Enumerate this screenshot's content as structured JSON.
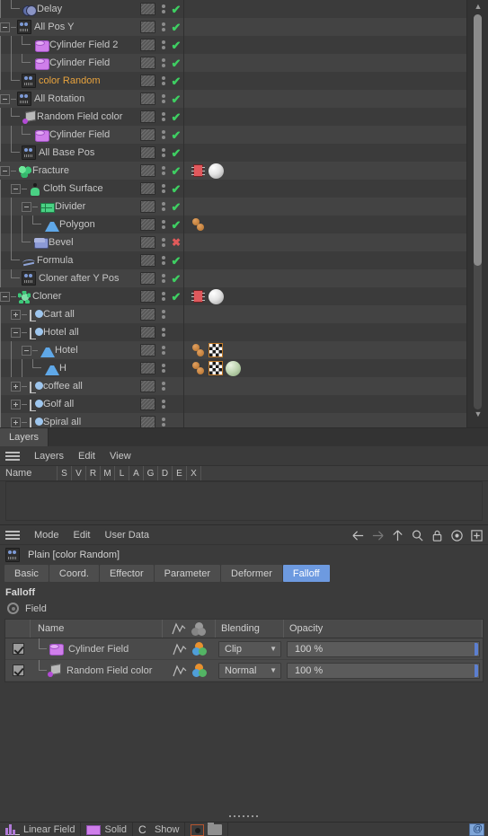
{
  "object_manager": {
    "rows": [
      {
        "label": "Delay",
        "depth": 1,
        "expander": "none",
        "icon": "delay-icon",
        "check": "on",
        "tags": []
      },
      {
        "label": "All Pos Y",
        "depth": 0,
        "expander": "minus",
        "icon": "effector-icon",
        "check": "on",
        "tags": []
      },
      {
        "label": "Cylinder Field 2",
        "depth": 2,
        "expander": "none",
        "icon": "cylinder-field-icon",
        "check": "on",
        "tags": []
      },
      {
        "label": "Cylinder Field",
        "depth": 2,
        "expander": "none",
        "icon": "cylinder-field-icon",
        "check": "on",
        "tags": []
      },
      {
        "label": "color Random",
        "depth": 1,
        "expander": "none",
        "icon": "effector-icon",
        "check": "on",
        "selected": true,
        "tags": []
      },
      {
        "label": "All Rotation",
        "depth": 0,
        "expander": "minus",
        "icon": "effector-icon",
        "check": "on",
        "tags": []
      },
      {
        "label": "Random Field color",
        "depth": 1,
        "expander": "none",
        "icon": "random-field-icon",
        "check": "on",
        "tags": []
      },
      {
        "label": "Cylinder Field",
        "depth": 2,
        "expander": "none",
        "icon": "cylinder-field-icon",
        "check": "on",
        "tags": []
      },
      {
        "label": "All Base Pos",
        "depth": 1,
        "expander": "none",
        "icon": "effector-icon",
        "check": "on",
        "tags": []
      },
      {
        "label": "Fracture",
        "depth": 0,
        "expander": "minus",
        "icon": "fracture-icon",
        "check": "on",
        "tags": [
          "rigid-body-tag",
          "material-white"
        ]
      },
      {
        "label": "Cloth Surface",
        "depth": 1,
        "expander": "minus",
        "icon": "cloth-surface-icon",
        "check": "on",
        "tags": []
      },
      {
        "label": "Divider",
        "depth": 2,
        "expander": "minus",
        "icon": "divider-icon",
        "check": "on",
        "tags": []
      },
      {
        "label": "Polygon",
        "depth": 3,
        "expander": "none",
        "icon": "polygon-icon",
        "check": "on",
        "tags": [
          "dynamics-tag"
        ]
      },
      {
        "label": "Bevel",
        "depth": 2,
        "expander": "none",
        "icon": "bevel-icon",
        "check": "off",
        "tags": []
      },
      {
        "label": "Formula",
        "depth": 1,
        "expander": "none",
        "icon": "formula-icon",
        "check": "on",
        "tags": []
      },
      {
        "label": "Cloner after Y Pos",
        "depth": 1,
        "expander": "none",
        "icon": "effector-icon",
        "check": "on",
        "tags": []
      },
      {
        "label": "Cloner",
        "depth": 0,
        "expander": "minus",
        "icon": "cloner-icon",
        "check": "on",
        "tags": [
          "rigid-body-tag",
          "material-white"
        ]
      },
      {
        "label": "Cart all",
        "depth": 1,
        "expander": "plus",
        "icon": "null-object-icon",
        "check": "none",
        "tags": []
      },
      {
        "label": "Hotel all",
        "depth": 1,
        "expander": "minus",
        "icon": "null-object-icon",
        "check": "none",
        "tags": []
      },
      {
        "label": "Hotel",
        "depth": 2,
        "expander": "minus",
        "icon": "polygon-icon",
        "check": "none",
        "tags": [
          "dynamics-tag",
          "checker-texture-tag"
        ]
      },
      {
        "label": "H",
        "depth": 3,
        "expander": "none",
        "icon": "polygon-icon",
        "check": "none",
        "tags": [
          "dynamics-tag",
          "checker-texture-tag",
          "material-green"
        ]
      },
      {
        "label": "coffee all",
        "depth": 1,
        "expander": "plus",
        "icon": "null-object-icon",
        "check": "none",
        "tags": []
      },
      {
        "label": "Golf all",
        "depth": 1,
        "expander": "plus",
        "icon": "null-object-icon",
        "check": "none",
        "tags": []
      },
      {
        "label": "Spiral all",
        "depth": 1,
        "expander": "plus",
        "icon": "null-object-icon",
        "check": "none",
        "tags": []
      }
    ]
  },
  "layers_panel": {
    "tab_label": "Layers",
    "menus": [
      "Layers",
      "Edit",
      "View"
    ],
    "columns": [
      "Name",
      "S",
      "V",
      "R",
      "M",
      "L",
      "A",
      "G",
      "D",
      "E",
      "X"
    ]
  },
  "attribute_manager": {
    "menus": [
      "Mode",
      "Edit",
      "User Data"
    ],
    "nav_icons": [
      "back-arrow-icon",
      "forward-arrow-icon",
      "up-arrow-icon",
      "search-icon",
      "lock-icon",
      "target-icon",
      "add-icon"
    ],
    "object_title": "Plain [color Random]",
    "tabs": [
      {
        "label": "Basic",
        "active": false
      },
      {
        "label": "Coord.",
        "active": false
      },
      {
        "label": "Effector",
        "active": false
      },
      {
        "label": "Parameter",
        "active": false
      },
      {
        "label": "Deformer",
        "active": false
      },
      {
        "label": "Falloff",
        "active": true
      }
    ],
    "section_title": "Falloff",
    "mode_label": "Field",
    "field_list": {
      "headers": {
        "name": "Name",
        "blending": "Blending",
        "opacity": "Opacity"
      },
      "rows": [
        {
          "checked": true,
          "name": "Cylinder Field",
          "icon": "cylinder-field-icon",
          "blending": "Clip",
          "opacity": "100 %"
        },
        {
          "checked": true,
          "name": "Random Field color",
          "icon": "random-field-icon",
          "blending": "Normal",
          "opacity": "100 %"
        }
      ]
    }
  },
  "bottom_strip": {
    "items": [
      {
        "label": "Linear Field",
        "icon": "linear-field-icon"
      },
      {
        "label": "Solid",
        "icon": "solid-swatch-icon"
      },
      {
        "label": "Show",
        "icon": "c-icon"
      }
    ],
    "right_icon": "at-icon"
  },
  "colors": {
    "background": "#3b3b3b",
    "row_alt": "#434343",
    "accent_selected": "#e8a33d",
    "tab_active": "#6d9ae0",
    "check_on": "#3ecf62",
    "check_off": "#e05a5a",
    "slider_handle": "#5c7fd0"
  }
}
